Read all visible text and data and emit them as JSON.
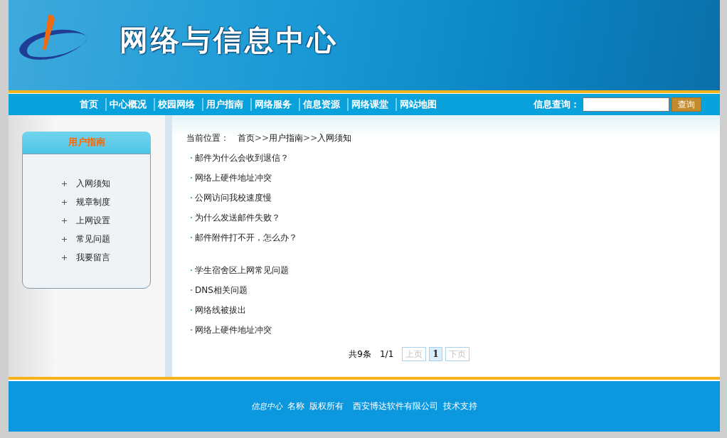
{
  "header": {
    "title": "网络与信息中心"
  },
  "nav": {
    "items": [
      {
        "label": "首页"
      },
      {
        "label": "中心概况"
      },
      {
        "label": "校园网络"
      },
      {
        "label": "用户指南"
      },
      {
        "label": "网络服务"
      },
      {
        "label": "信息资源"
      },
      {
        "label": "网络课堂"
      },
      {
        "label": "网站地图"
      }
    ],
    "search_label": "信息查询：",
    "search_button": "查询"
  },
  "sidebar": {
    "title": "用户指南",
    "items": [
      {
        "label": "入网须知"
      },
      {
        "label": "规章制度"
      },
      {
        "label": "上网设置"
      },
      {
        "label": "常见问题"
      },
      {
        "label": "我要留言"
      }
    ]
  },
  "breadcrumb": {
    "label": "当前位置：",
    "path": [
      {
        "label": "首页"
      },
      {
        "label": "用户指南"
      },
      {
        "label": "入网须知"
      }
    ],
    "separator": ">>"
  },
  "article_groups": [
    [
      "邮件为什么会收到退信？",
      "网络上硬件地址冲突",
      "公网访问我校速度慢",
      "为什么发送邮件失败？",
      "邮件附件打不开，怎么办？"
    ],
    [
      "学生宿舍区上网常见问题",
      "DNS相关问题",
      "网络线被拔出",
      "网络上硬件地址冲突"
    ]
  ],
  "pagination": {
    "total": "共9条",
    "page": "1/1",
    "buttons": [
      {
        "label": "上页",
        "disabled": true,
        "selected": false
      },
      {
        "label": "1",
        "disabled": false,
        "selected": true
      },
      {
        "label": "下页",
        "disabled": true,
        "selected": false
      }
    ]
  },
  "footer": {
    "brand": "信息中心",
    "texts": [
      "名称",
      "版权所有",
      "西安博达软件有限公司",
      "技术支持"
    ]
  }
}
